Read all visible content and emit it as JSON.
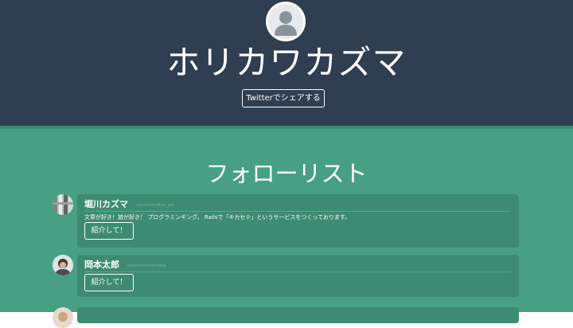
{
  "header": {
    "title": "ホリカワカズマ",
    "share_label": "Twitterでシェアする"
  },
  "follow": {
    "title": "フォローリスト",
    "users": [
      {
        "name": "堀川カズマ",
        "handle": "tenntenn9ya_ed",
        "description": "文章が好き！旅が好き！ プログラミンギング。 Railsで「キカセテ」というサービスをつくっております。",
        "button": "紹介して！"
      },
      {
        "name": "岡本太郎",
        "handle": "okamotaroshiaka",
        "description": "",
        "button": "紹介して！"
      }
    ]
  },
  "colors": {
    "header_bg": "#2f3e50",
    "main_bg": "#48a084",
    "card_bg": "#3d8b72"
  }
}
